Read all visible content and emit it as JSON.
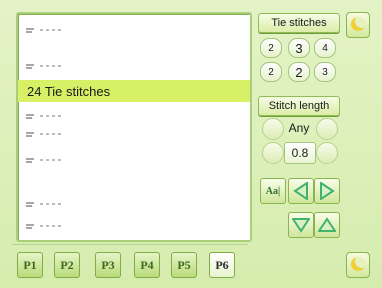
{
  "list": {
    "selected_label": "24 Tie stitches"
  },
  "tie_stitches": {
    "label": "Tie stitches",
    "row1": [
      "2",
      "3",
      "4"
    ],
    "row2": [
      "2",
      "2",
      "3"
    ]
  },
  "stitch_length": {
    "label": "Stitch length",
    "any_label": "Any",
    "value": "0.8"
  },
  "controls": {
    "aaa_label": "Aa|"
  },
  "tabs": [
    {
      "label": "P1"
    },
    {
      "label": "P2"
    },
    {
      "label": "P3"
    },
    {
      "label": "P4"
    },
    {
      "label": "P5"
    },
    {
      "label": "P6"
    }
  ],
  "colors": {
    "selected_row": "#d7f066",
    "arrow": "#43b26a",
    "background": "#dcefb8"
  }
}
